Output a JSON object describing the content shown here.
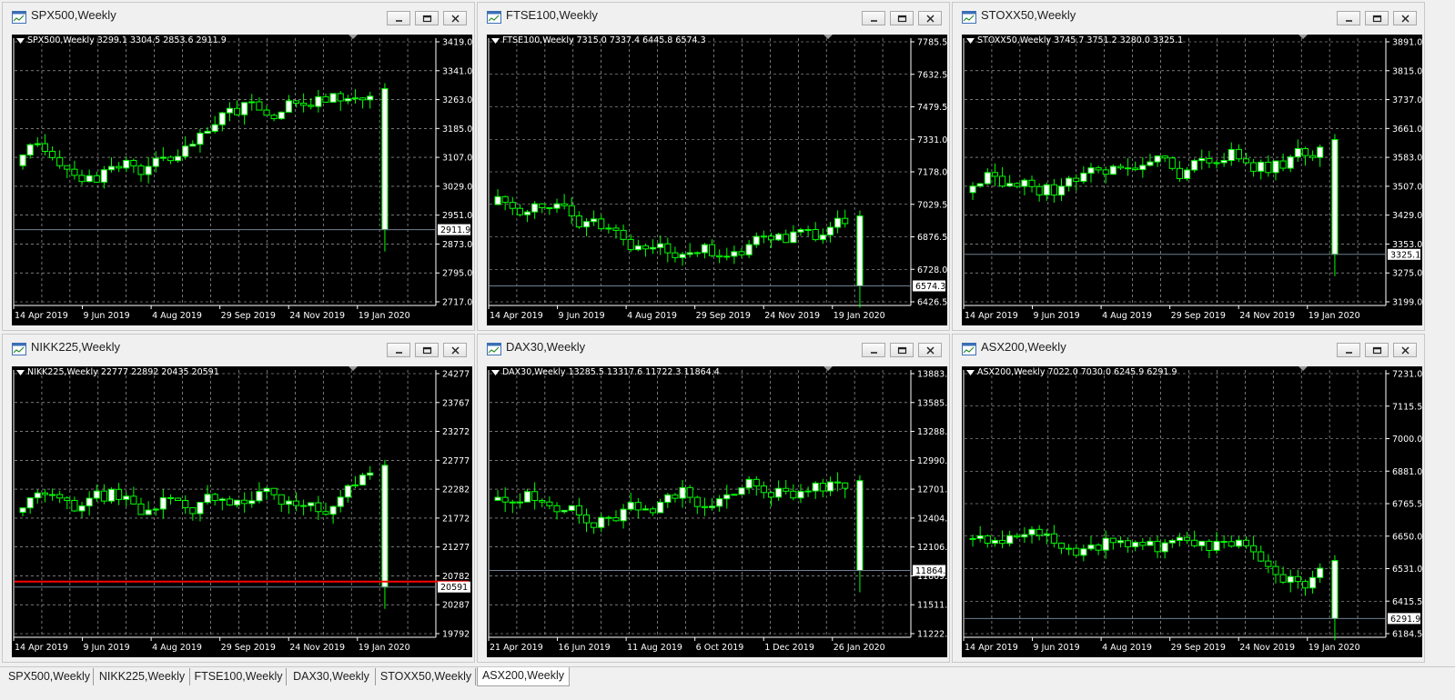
{
  "windows": [
    {
      "id": "spx",
      "title": "SPX500,Weekly",
      "info": "SPX500,Weekly  3299.1 3304.5 2853.6 2911.9",
      "price_labels": [
        "3419.0",
        "3341.0",
        "3263.0",
        "3185.0",
        "3107.0",
        "3029.0",
        "2951.0",
        "2873.0",
        "2795.0",
        "2717.0"
      ],
      "date_labels": [
        "14 Apr 2019",
        "9 Jun 2019",
        "4 Aug 2019",
        "29 Sep 2019",
        "24 Nov 2019",
        "19 Jan 2020"
      ],
      "current_price": "2911.9"
    },
    {
      "id": "ftse",
      "title": "FTSE100,Weekly",
      "info": "FTSE100,Weekly  7315.0 7337.4 6445.8 6574.3",
      "price_labels": [
        "7785.5",
        "7632.5",
        "7479.5",
        "7331.0",
        "7178.0",
        "7029.5",
        "6876.5",
        "6728.0",
        "6574.3",
        "6426.5"
      ],
      "date_labels": [
        "14 Apr 2019",
        "9 Jun 2019",
        "4 Aug 2019",
        "29 Sep 2019",
        "24 Nov 2019",
        "19 Jan 2020"
      ],
      "current_price": "6574.3"
    },
    {
      "id": "stoxx",
      "title": "STOXX50,Weekly",
      "info": "STOXX50,Weekly  3745.7 3751.2 3280.0 3325.1",
      "price_labels": [
        "3891.0",
        "3815.0",
        "3737.0",
        "3661.0",
        "3583.0",
        "3507.0",
        "3429.0",
        "3353.0",
        "3325.1",
        "3275.0",
        "3199.0"
      ],
      "date_labels": [
        "14 Apr 2019",
        "9 Jun 2019",
        "4 Aug 2019",
        "29 Sep 2019",
        "24 Nov 2019",
        "19 Jan 2020"
      ],
      "current_price": "3325.1"
    },
    {
      "id": "nikk",
      "title": "NIKK225,Weekly",
      "info": "NIKK225,Weekly  22777 22892 20435 20591",
      "price_labels": [
        "24277",
        "23767",
        "23272",
        "22777",
        "22282",
        "21772",
        "21277",
        "20782",
        "20591",
        "20287",
        "19792"
      ],
      "date_labels": [
        "14 Apr 2019",
        "9 Jun 2019",
        "4 Aug 2019",
        "29 Sep 2019",
        "24 Nov 2019",
        "19 Jan 2020"
      ],
      "current_price": "20591"
    },
    {
      "id": "dax",
      "title": "DAX30,Weekly",
      "info": "DAX30,Weekly  13285.5 13317.6 11722.3 11864.4",
      "price_labels": [
        "13883.0",
        "13585.5",
        "13288.0",
        "12990.5",
        "12701.5",
        "12404.0",
        "12106.5",
        "11864.4",
        "11809.0",
        "11511.5",
        "11222.5"
      ],
      "date_labels": [
        "21 Apr 2019",
        "16 Jun 2019",
        "11 Aug 2019",
        "6 Oct 2019",
        "1 Dec 2019",
        "26 Jan 2020"
      ],
      "current_price": "11864.4"
    },
    {
      "id": "asx",
      "title": "ASX200,Weekly",
      "info": "ASX200,Weekly  7022.0 7030.0 6245.9 6291.9",
      "price_labels": [
        "7231.0",
        "7115.5",
        "7000.0",
        "6881.0",
        "6765.5",
        "6650.0",
        "6531.0",
        "6415.5",
        "6291.9",
        "6184.5"
      ],
      "date_labels": [
        "14 Apr 2019",
        "9 Jun 2019",
        "4 Aug 2019",
        "29 Sep 2019",
        "24 Nov 2019",
        "19 Jan 2020"
      ],
      "current_price": "6291.9"
    }
  ],
  "tabs": [
    "SPX500,Weekly",
    "NIKK225,Weekly",
    "FTSE100,Weekly",
    "DAX30,Weekly",
    "STOXX50,Weekly",
    "ASX200,Weekly"
  ],
  "active_tab": "ASX200,Weekly",
  "colors": {
    "chart_background": "#000000",
    "grid": "#c0c0c0",
    "candle_bull_fill": "#ffffff",
    "candle_bear_fill": "#000000",
    "candle_outline": "#00ff00",
    "bid_line": "#708090",
    "red_level_line": "#ff0000",
    "window_chrome": "#f0f0f0"
  }
}
